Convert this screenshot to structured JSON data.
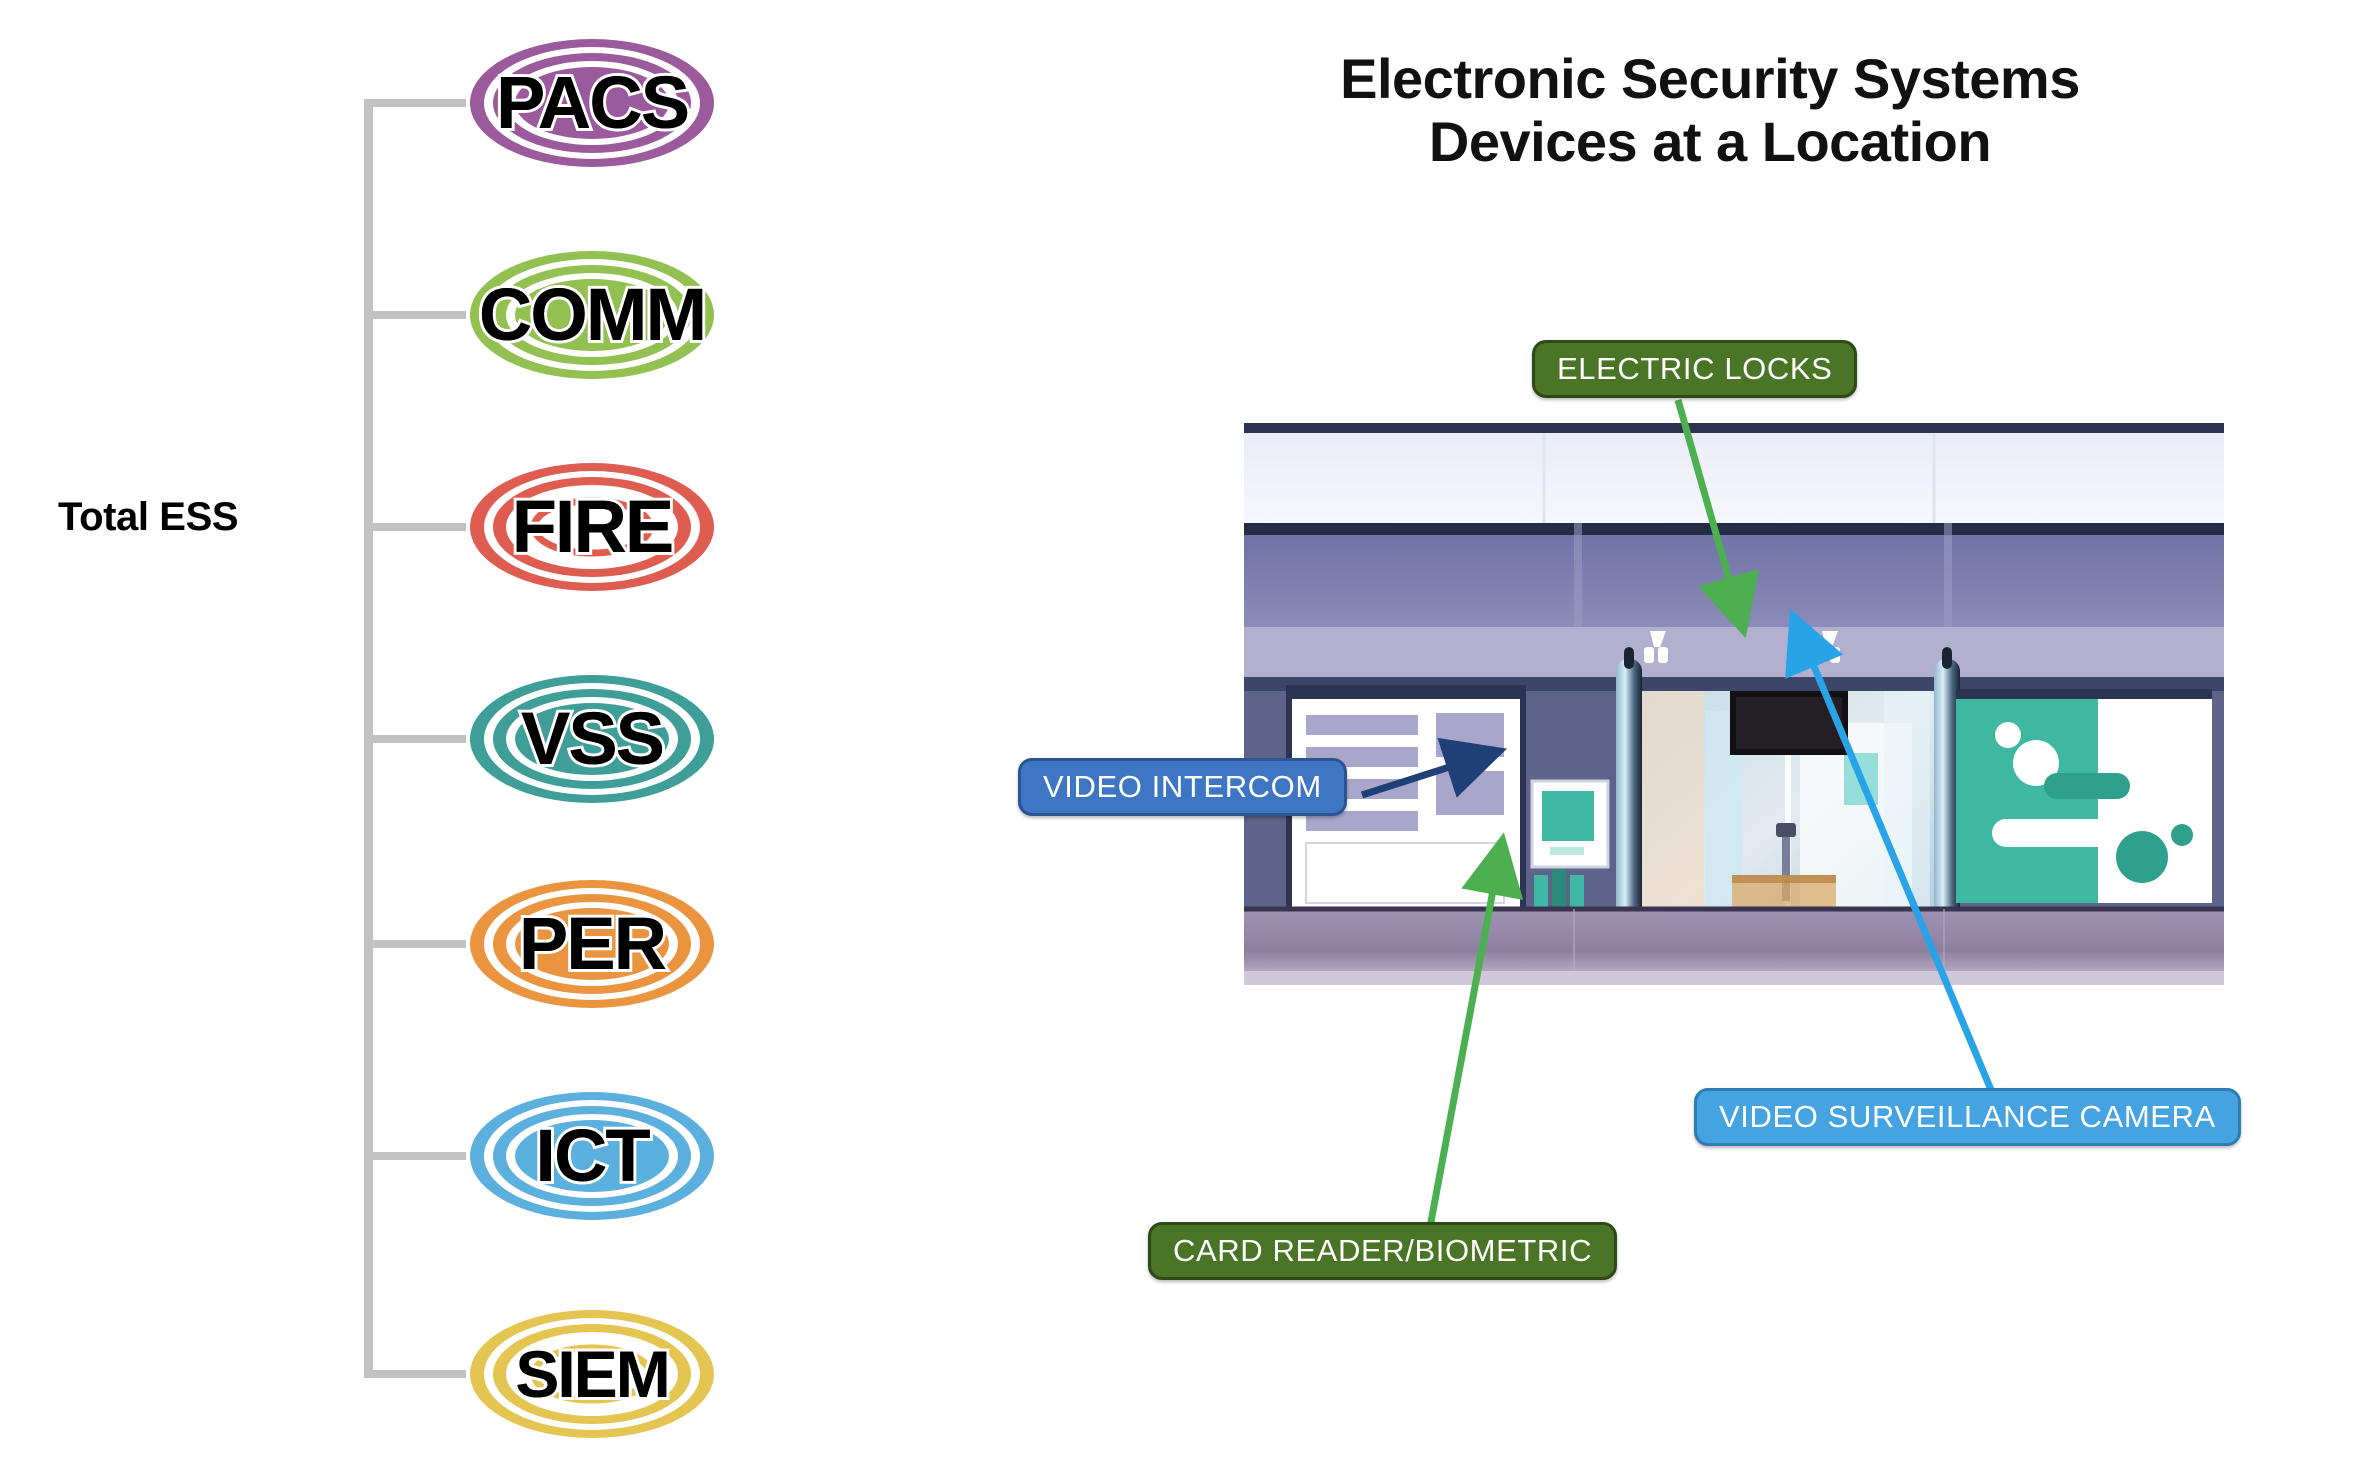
{
  "headline": {
    "line1": "Electronic Security Systems",
    "line2": "Devices at a Location"
  },
  "taxonomy": {
    "root_label": "Total ESS",
    "items": [
      {
        "label": "PACS",
        "color": "#9b5a9b",
        "filled": true,
        "icon": "pacs-badge"
      },
      {
        "label": "COMM",
        "color": "#92c051",
        "filled": true,
        "icon": "comm-badge"
      },
      {
        "label": "FIRE",
        "color": "#df5c51",
        "filled": false,
        "icon": "fire-badge"
      },
      {
        "label": "VSS",
        "color": "#3f9e97",
        "filled": true,
        "icon": "vss-badge"
      },
      {
        "label": "PER",
        "color": "#eb9440",
        "filled": true,
        "icon": "per-badge"
      },
      {
        "label": "ICT",
        "color": "#5cb0de",
        "filled": true,
        "icon": "ict-badge"
      },
      {
        "label": "SIEM",
        "color": "#e5c551",
        "filled": false,
        "icon": "siem-badge"
      }
    ]
  },
  "scene": {
    "name": "building-lobby-security-entrance-illustration",
    "callouts": [
      {
        "id": "electric-locks",
        "label": "ELECTRIC LOCKS",
        "style": "green",
        "leader_color": "#4caf50"
      },
      {
        "id": "video-intercom",
        "label": "VIDEO INTERCOM",
        "style": "blue-dark",
        "leader_color": "#1f3f77"
      },
      {
        "id": "video-surveillance",
        "label": "VIDEO SURVEILLANCE CAMERA",
        "style": "blue-light",
        "leader_color": "#29a3e8"
      },
      {
        "id": "card-reader",
        "label": "CARD READER/BIOMETRIC",
        "style": "green",
        "leader_color": "#4caf50"
      }
    ]
  },
  "colors": {
    "bracket": "#c2c2c2",
    "headline": "#111111",
    "callout_green": "#4a7426",
    "callout_blue_dark": "#3f76c4",
    "callout_blue_light": "#46a3e2"
  }
}
